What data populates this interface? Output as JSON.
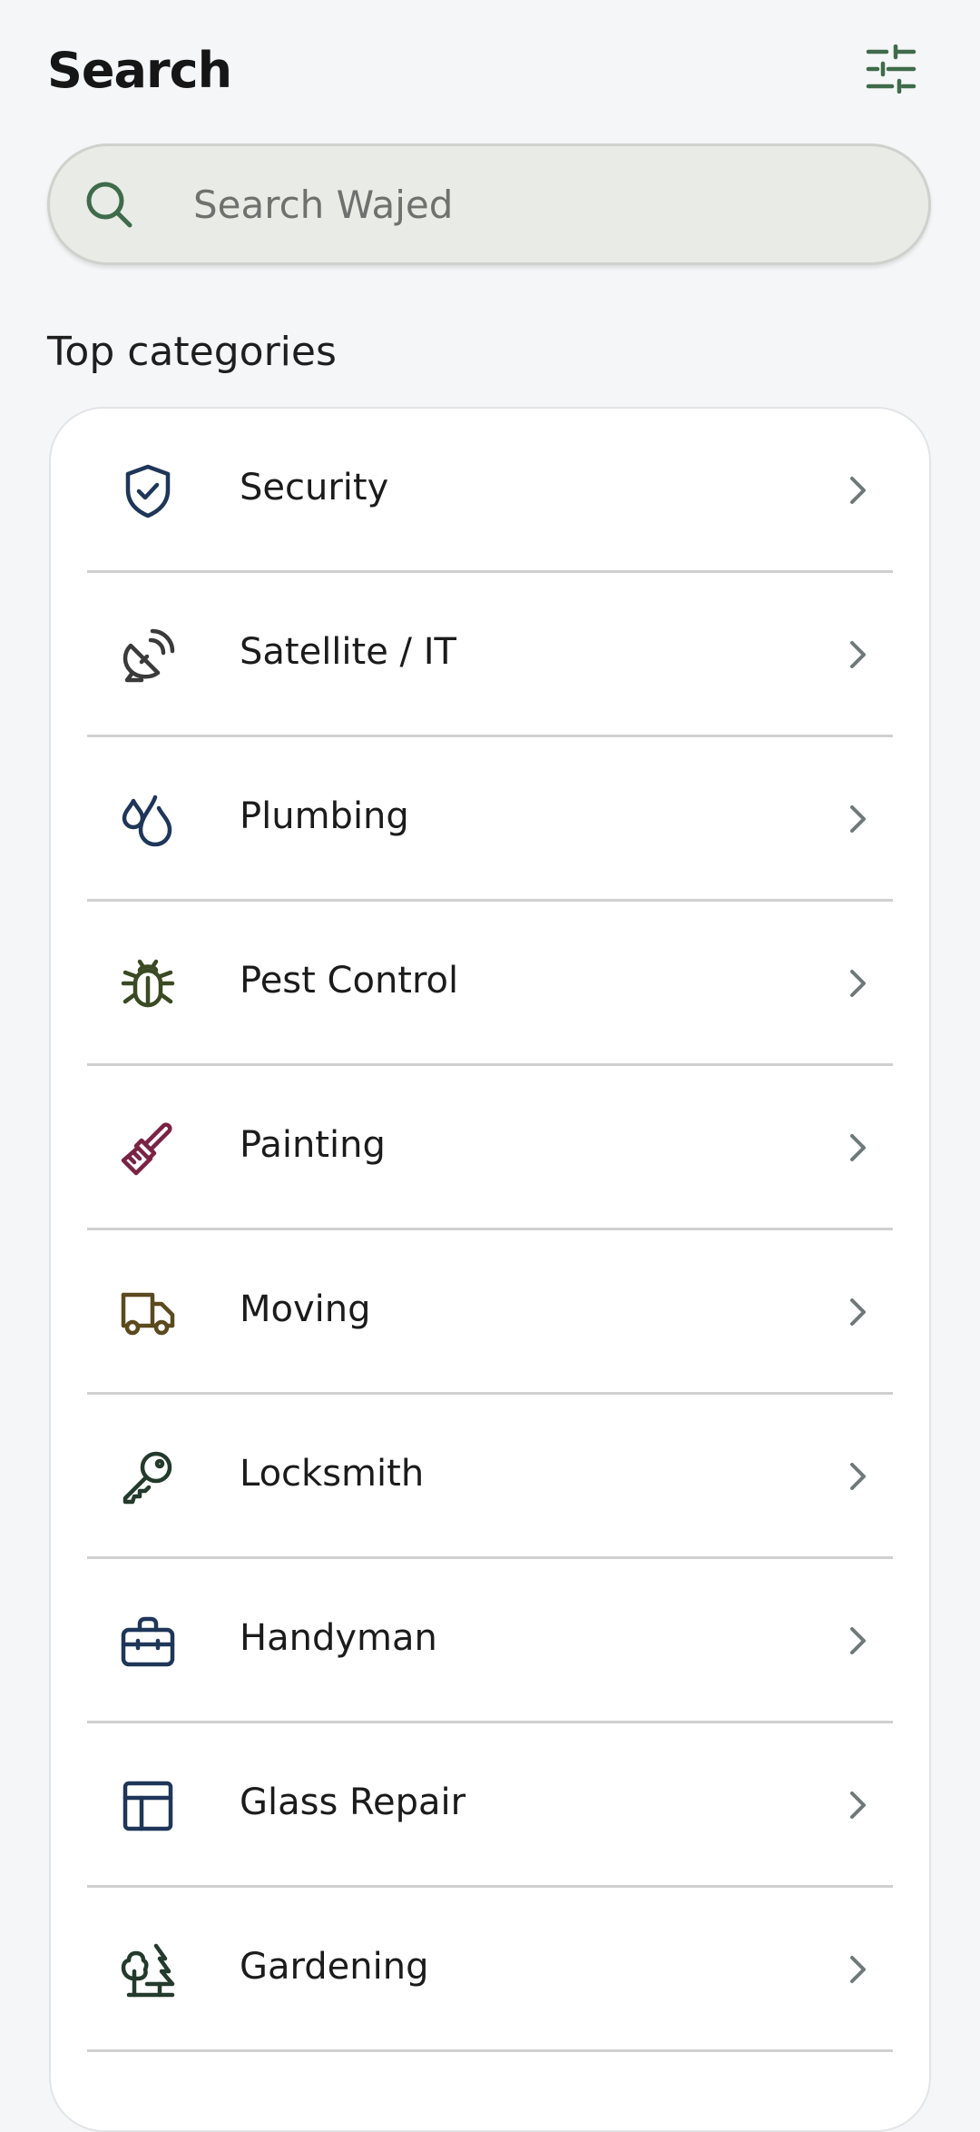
{
  "header": {
    "title": "Search",
    "filter_icon": "sliders-icon"
  },
  "search": {
    "placeholder": "Search Wajed",
    "value": "",
    "icon": "search-icon"
  },
  "section": {
    "title": "Top categories"
  },
  "colors": {
    "accent": "#3f6b4a",
    "background": "#f5f6f8",
    "search_bg": "#e9ebe6",
    "card_bg": "#ffffff",
    "divider": "#cfd0cf",
    "chevron": "#6f7a78"
  },
  "categories": [
    {
      "label": "Security",
      "icon": "shield-check-icon",
      "color": "#1e3658"
    },
    {
      "label": "Satellite / IT",
      "icon": "satellite-dish-icon",
      "color": "#3a3a3a"
    },
    {
      "label": "Plumbing",
      "icon": "droplets-icon",
      "color": "#1e3658"
    },
    {
      "label": "Pest Control",
      "icon": "bug-icon",
      "color": "#3a4a22"
    },
    {
      "label": "Painting",
      "icon": "paintbrush-icon",
      "color": "#7a2343"
    },
    {
      "label": "Moving",
      "icon": "truck-icon",
      "color": "#5a4a1e"
    },
    {
      "label": "Locksmith",
      "icon": "key-icon",
      "color": "#243a2c"
    },
    {
      "label": "Handyman",
      "icon": "toolbox-icon",
      "color": "#1e3658"
    },
    {
      "label": "Glass Repair",
      "icon": "window-icon",
      "color": "#1e3658"
    },
    {
      "label": "Gardening",
      "icon": "trees-icon",
      "color": "#243a2c"
    }
  ]
}
